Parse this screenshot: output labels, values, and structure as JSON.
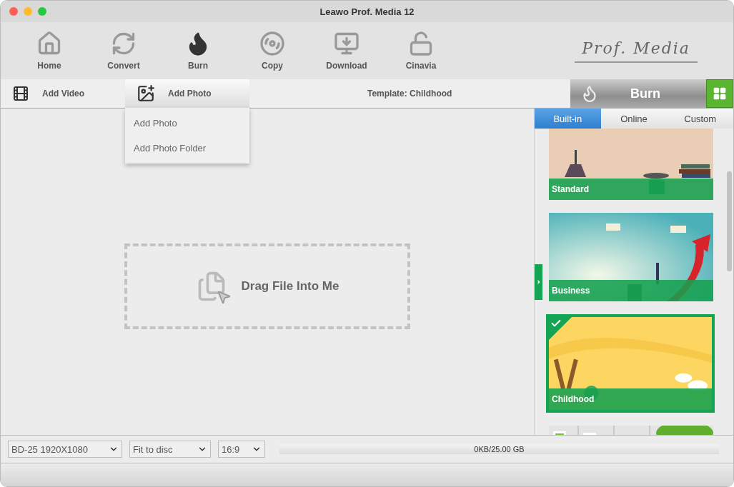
{
  "window": {
    "title": "Leawo Prof. Media 12"
  },
  "toolbar": {
    "items": [
      {
        "label": "Home",
        "kind": "home",
        "selected": false
      },
      {
        "label": "Convert",
        "kind": "convert",
        "selected": false
      },
      {
        "label": "Burn",
        "kind": "burn",
        "selected": true
      },
      {
        "label": "Copy",
        "kind": "copy",
        "selected": false
      },
      {
        "label": "Download",
        "kind": "download",
        "selected": false
      },
      {
        "label": "Cinavia",
        "kind": "cinavia",
        "selected": false
      }
    ],
    "logo": "Prof. Media"
  },
  "actions": {
    "add_video": "Add Video",
    "add_photo": {
      "label": "Add Photo",
      "expanded": true,
      "menu": [
        "Add Photo",
        "Add Photo Folder"
      ]
    },
    "template_label": "Template: Childhood",
    "burn_button": "Burn"
  },
  "drop_zone": {
    "text": "Drag File Into Me"
  },
  "template_panel": {
    "tabs": [
      {
        "label": "Built-in",
        "selected": true
      },
      {
        "label": "Online",
        "selected": false
      },
      {
        "label": "Custom",
        "selected": false
      }
    ],
    "templates": [
      {
        "name": "Standard",
        "selected": false
      },
      {
        "name": "Business",
        "selected": false
      },
      {
        "name": "Childhood",
        "selected": true
      },
      {
        "selected": false
      }
    ]
  },
  "bottom_bar": {
    "disc": "BD-25 1920X1080",
    "fit": "Fit to disc",
    "aspect": "16:9",
    "capacity": {
      "text": "0KB/25.00 GB"
    }
  }
}
